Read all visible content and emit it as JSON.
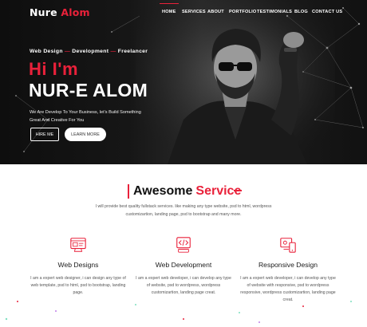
{
  "brand": {
    "part1": "Nure ",
    "part2": "Alom",
    "accent": "#e9213a"
  },
  "nav": [
    "HOME",
    "SERVICES",
    "ABOUT",
    "PORTFOLIO",
    "TESTIMONIALS",
    "BLOG",
    "CONTACT US"
  ],
  "hero": {
    "role1": "Web Design",
    "sep": "—",
    "role2": "Development",
    "role3": "Freelancer",
    "greeting": "Hi I'm",
    "name": "NUR-E ALOM",
    "description": "We Are Develop To Your Business, let's Build Something Great And Creative For You",
    "hire_button": "HIRE ME",
    "learn_button": "LEARN MORE"
  },
  "services": {
    "title_part1": "Awesome",
    "title_part2": "Service",
    "intro": "I will provide best quality fullstack services. like making any type website, psd to html, wordpress customizartion, landing page, psd to bootstrap and many more.",
    "items": [
      {
        "icon": "web-design-icon",
        "title": "Web Designs",
        "text": "I am a expert web designer, i can design any type of web template, psd to html, psd to bootstrap, landing page."
      },
      {
        "icon": "web-development-icon",
        "title": "Web Development",
        "text": "I am a expert web developer, i can develop any type of website, psd to wordpress, wordpress customizartion, landing page creat."
      },
      {
        "icon": "responsive-design-icon",
        "title": "Responsive Design",
        "text": "I am a expert web developer, i can develop any type of website with responsive, psd to wordpress responsive, wordpress customizartion, landing page creat."
      }
    ]
  }
}
